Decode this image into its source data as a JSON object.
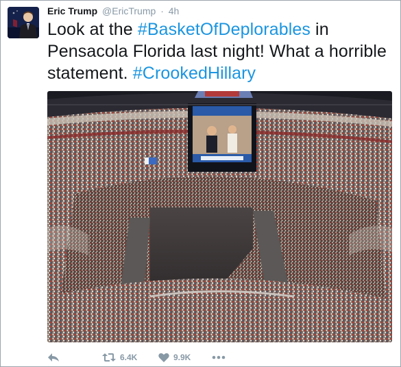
{
  "tweet": {
    "author_name": "Eric Trump",
    "handle": "@EricTrump",
    "separator": "·",
    "time": "4h",
    "text_parts": [
      "Look at the ",
      "#BasketOfDeplorables",
      " in Pensacola Florida last night! What a horrible statement. ",
      "#CrookedHillary"
    ]
  },
  "actions": {
    "reply_icon": "reply-icon",
    "retweet_icon": "retweet-icon",
    "retweet_count": "6.4K",
    "like_icon": "heart-icon",
    "like_count": "9.9K",
    "more_icon": "more-icon"
  },
  "colors": {
    "hashtag": "#1b95e0",
    "muted": "#8899a6",
    "text": "#14171a"
  }
}
